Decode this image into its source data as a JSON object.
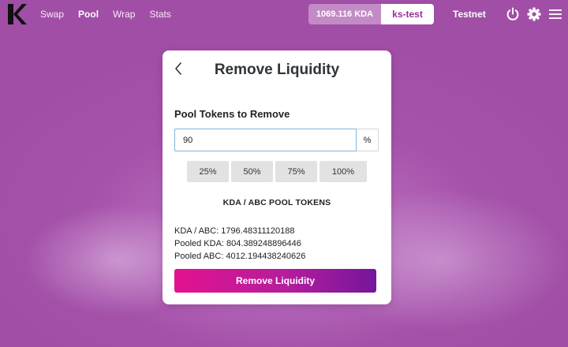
{
  "brand": {
    "logo_letter": "K"
  },
  "nav": {
    "items": [
      {
        "label": "Swap",
        "active": false
      },
      {
        "label": "Pool",
        "active": true
      },
      {
        "label": "Wrap",
        "active": false
      },
      {
        "label": "Stats",
        "active": false
      }
    ]
  },
  "wallet": {
    "balance": "1069.116 KDA",
    "account": "ks-test"
  },
  "network": {
    "label": "Testnet"
  },
  "icons": {
    "power": "power-icon",
    "settings": "gear-icon",
    "menu": "hamburger-menu-icon",
    "back": "chevron-left-icon"
  },
  "card": {
    "title": "Remove Liquidity",
    "section_label": "Pool Tokens to Remove",
    "input_value": "90",
    "unit": "%",
    "presets": [
      "25%",
      "50%",
      "75%",
      "100%"
    ],
    "pool_heading": "KDA / ABC POOL TOKENS",
    "info": [
      "KDA / ABC: 1796.48311120188",
      "Pooled KDA: 804.389248896446",
      "Pooled ABC: 4012.194438240626"
    ],
    "submit_label": "Remove Liquidity"
  },
  "colors": {
    "background": "#a14ea6",
    "accent_start": "#e3128f",
    "accent_end": "#75159b",
    "account_text": "#9b2c9a"
  }
}
